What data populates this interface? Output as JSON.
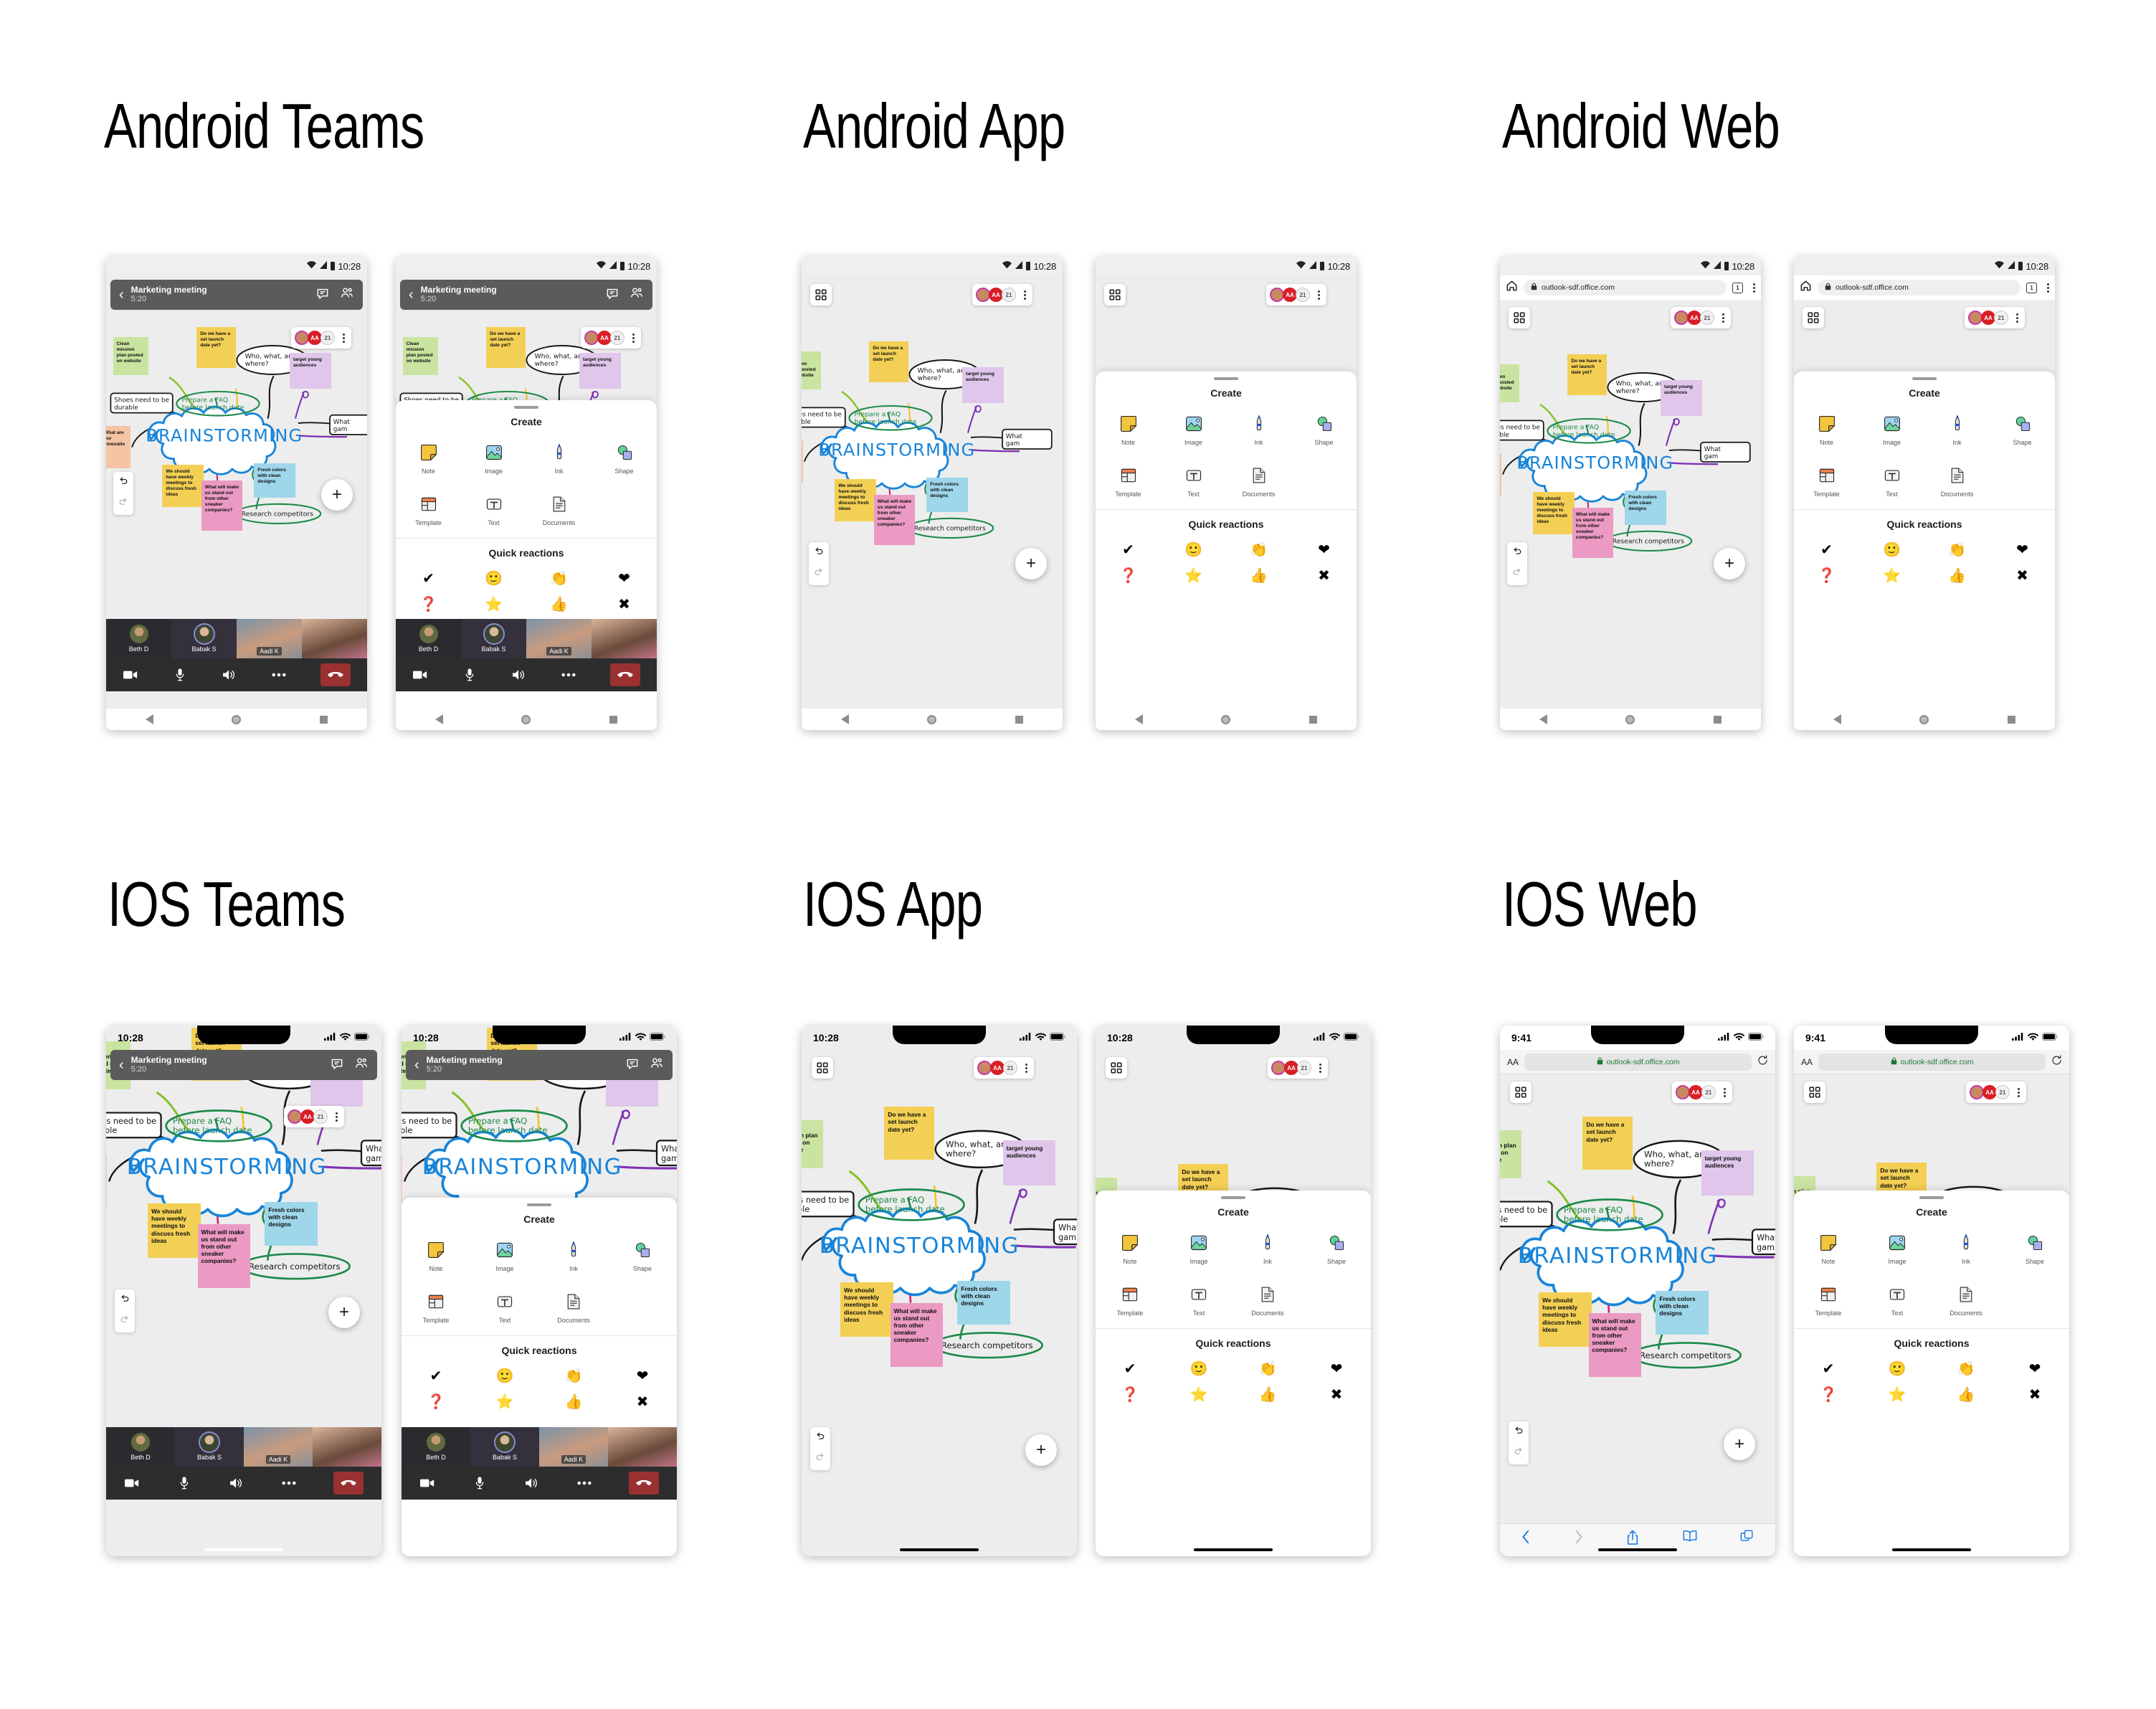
{
  "sections": [
    {
      "title": "Android Teams"
    },
    {
      "title": "Android App"
    },
    {
      "title": "Android Web"
    },
    {
      "title": "IOS Teams"
    },
    {
      "title": "IOS App"
    },
    {
      "title": "IOS Web"
    }
  ],
  "status": {
    "android_time": "10:28",
    "ios_time_1": "10:28",
    "ios_time_2": "9:41"
  },
  "teams_header": {
    "title": "Marketing meeting",
    "duration": "5:20",
    "chat_icon": "chat-bubble-icon",
    "people_icon": "people-icon",
    "back_icon": "chevron-left-icon"
  },
  "browser": {
    "url": "outlook-sdf.office.com",
    "tab_count": "1",
    "home_icon": "home-icon",
    "lock_icon": "lock-icon",
    "menu_icon": "kebab-menu-icon",
    "reload_icon": "reload-icon",
    "text_size_label": "AA"
  },
  "whiteboard": {
    "center_label": "BRAINSTORMING",
    "presence": {
      "extra_count": "21",
      "avatar_initials": "AA"
    },
    "grid_icon": "app-grid-icon",
    "kebab_icon": "kebab-menu-icon",
    "undo_icon": "undo-icon",
    "redo_icon": "redo-icon",
    "add_label": "+",
    "notes": [
      {
        "text": "Clean mission plan posted on website",
        "color": "#c9e4a0"
      },
      {
        "text": "Do we have a set launch date yet?",
        "color": "#f3d055"
      },
      {
        "text": "target young audiences",
        "color": "#dfc6ea"
      },
      {
        "text": "We should have weekly meetings to discuss fresh ideas",
        "color": "#f3d055"
      },
      {
        "text": "What will make us stand out from other sneaker companies?",
        "color": "#eb9ac4"
      },
      {
        "text": "Fresh colors with clean designs",
        "color": "#9ed6ea"
      },
      {
        "text": "What are our innovatio",
        "color": "#f5c4a5"
      }
    ],
    "ink_notes": [
      "Who, what, and where?",
      "Prepare a FAQ before launch date",
      "Shoes need to be durable",
      "Research competitors",
      "What gam"
    ],
    "colors": {
      "cloud": "#1884d9",
      "ink_green": "#1d8a4a",
      "ink_black": "#171717",
      "link_purple": "#8033b5",
      "link_pink": "#d6216f",
      "link_yellow": "#f0c52a",
      "link_lime": "#86c129"
    }
  },
  "create_sheet": {
    "title": "Create",
    "items": [
      {
        "label": "Note",
        "icon": "sticky-note-icon"
      },
      {
        "label": "Image",
        "icon": "image-icon"
      },
      {
        "label": "Ink",
        "icon": "ink-pen-icon"
      },
      {
        "label": "Shape",
        "icon": "shape-icon"
      },
      {
        "label": "Template",
        "icon": "template-icon"
      },
      {
        "label": "Text",
        "icon": "text-icon"
      },
      {
        "label": "Documents",
        "icon": "document-icon"
      }
    ],
    "reactions_title": "Quick reactions",
    "reactions": [
      {
        "name": "check-reaction",
        "glyph": "✔"
      },
      {
        "name": "smile-reaction",
        "glyph": "🙂"
      },
      {
        "name": "clap-reaction",
        "glyph": "👏"
      },
      {
        "name": "heart-reaction",
        "glyph": "❤"
      },
      {
        "name": "question-reaction",
        "glyph": "❓"
      },
      {
        "name": "star-reaction",
        "glyph": "⭐"
      },
      {
        "name": "thumbsup-reaction",
        "glyph": "👍"
      },
      {
        "name": "cross-reaction",
        "glyph": "✖"
      }
    ]
  },
  "call": {
    "participants": [
      {
        "name": "Beth D"
      },
      {
        "name": "Babak S"
      },
      {
        "name": "Aadi K"
      },
      {
        "name": ""
      }
    ],
    "controls": [
      {
        "name": "video-toggle",
        "icon": "video-camera-icon"
      },
      {
        "name": "mic-toggle",
        "icon": "microphone-icon"
      },
      {
        "name": "speaker-toggle",
        "icon": "speaker-icon"
      },
      {
        "name": "more-options",
        "icon": "ellipsis-icon"
      },
      {
        "name": "hang-up",
        "icon": "phone-hangup-icon"
      }
    ]
  },
  "android_nav": {
    "back": "back-triangle-icon",
    "home": "home-circle-icon",
    "recents": "recents-square-icon"
  },
  "safari_nav": [
    {
      "name": "safari-back",
      "icon": "chevron-left-icon"
    },
    {
      "name": "safari-forward",
      "icon": "chevron-right-icon"
    },
    {
      "name": "safari-share",
      "icon": "share-icon"
    },
    {
      "name": "safari-bookmarks",
      "icon": "book-icon"
    },
    {
      "name": "safari-tabs",
      "icon": "tabs-icon"
    }
  ]
}
